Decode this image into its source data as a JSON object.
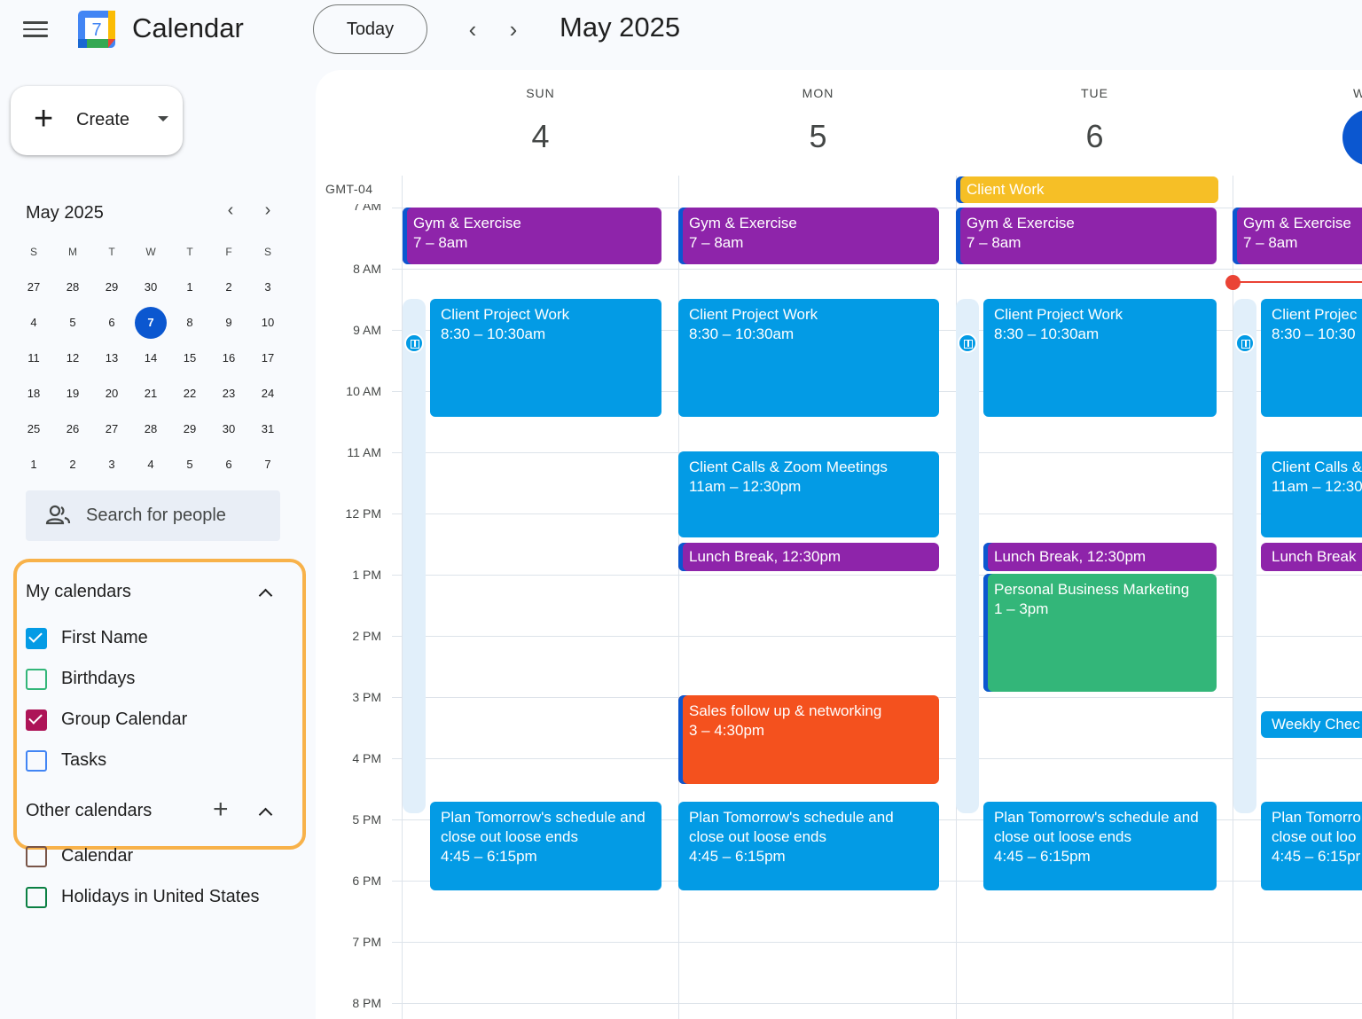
{
  "app": {
    "title": "Calendar",
    "logo_day": "7"
  },
  "topbar": {
    "today_label": "Today",
    "prev": "‹",
    "next": "›",
    "period": "May 2025"
  },
  "sidebar": {
    "create_label": "Create",
    "mini_calendar": {
      "title": "May 2025",
      "weekday_headers": [
        "S",
        "M",
        "T",
        "W",
        "T",
        "F",
        "S"
      ],
      "weeks": [
        [
          "27",
          "28",
          "29",
          "30",
          "1",
          "2",
          "3"
        ],
        [
          "4",
          "5",
          "6",
          "7",
          "8",
          "9",
          "10"
        ],
        [
          "11",
          "12",
          "13",
          "14",
          "15",
          "16",
          "17"
        ],
        [
          "18",
          "19",
          "20",
          "21",
          "22",
          "23",
          "24"
        ],
        [
          "25",
          "26",
          "27",
          "28",
          "29",
          "30",
          "31"
        ],
        [
          "1",
          "2",
          "3",
          "4",
          "5",
          "6",
          "7"
        ]
      ],
      "today": "7"
    },
    "search_placeholder": "Search for people",
    "my_calendars": {
      "title": "My calendars",
      "items": [
        {
          "name": "First Name",
          "checked": true,
          "color": "#039be5"
        },
        {
          "name": "Birthdays",
          "checked": false,
          "color": "#33b679"
        },
        {
          "name": "Group Calendar",
          "checked": true,
          "color": "#ad1457"
        },
        {
          "name": "Tasks",
          "checked": false,
          "color": "#4285f4"
        }
      ]
    },
    "other_calendars": {
      "title": "Other calendars",
      "items": [
        {
          "name": "Calendar",
          "checked": false,
          "color": "#795548"
        },
        {
          "name": "Holidays in United States",
          "checked": false,
          "color": "#0b8043"
        }
      ]
    }
  },
  "grid": {
    "timezone": "GMT-04",
    "hours": [
      "7 AM",
      "8 AM",
      "9 AM",
      "10 AM",
      "11 AM",
      "12 PM",
      "1 PM",
      "2 PM",
      "3 PM",
      "4 PM",
      "5 PM",
      "6 PM",
      "7 PM",
      "8 PM"
    ],
    "days": [
      {
        "dow": "SUN",
        "num": "4"
      },
      {
        "dow": "MON",
        "num": "5"
      },
      {
        "dow": "TUE",
        "num": "6"
      },
      {
        "dow": "W",
        "num": ""
      }
    ]
  },
  "events": {
    "allday_client_work": "Client Work",
    "gym_title": "Gym & Exercise",
    "gym_time": "7 – 8am",
    "project_title": "Client Project Work",
    "project_time": "8:30 – 10:30am",
    "project_title_cut": "Client Projec",
    "project_time_cut": "8:30 – 10:30",
    "calls_title": "Client Calls & Zoom Meetings",
    "calls_time": "11am – 12:30pm",
    "calls_title_cut": "Client Calls &",
    "calls_time_cut": "11am – 12:30",
    "lunch": "Lunch Break, 12:30pm",
    "lunch_cut": "Lunch Break",
    "marketing_title": "Personal Business Marketing",
    "marketing_time": "1 – 3pm",
    "sales_title": "Sales follow up & networking",
    "sales_time": "3 – 4:30pm",
    "weekly_cut": "Weekly Chec",
    "plan_title": "Plan Tomorrow's schedule and close out loose ends",
    "plan_time": "4:45 – 6:15pm",
    "plan_title_cut_1": "Plan Tomorro",
    "plan_title_cut_2": "close out loo",
    "plan_time_cut": "4:45 – 6:15pr"
  }
}
